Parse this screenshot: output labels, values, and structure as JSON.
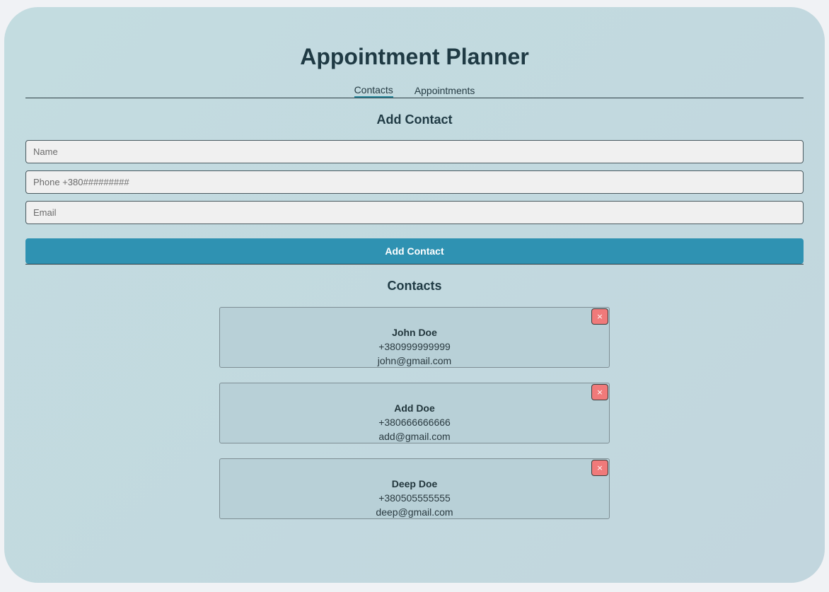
{
  "app": {
    "title": "Appointment Planner"
  },
  "nav": {
    "items": [
      {
        "label": "Contacts",
        "active": true
      },
      {
        "label": "Appointments",
        "active": false
      }
    ]
  },
  "add_contact": {
    "heading": "Add Contact",
    "fields": {
      "name": {
        "placeholder": "Name",
        "value": ""
      },
      "phone": {
        "placeholder": "Phone +380#########",
        "value": ""
      },
      "email": {
        "placeholder": "Email",
        "value": ""
      }
    },
    "submit_label": "Add Contact"
  },
  "contacts": {
    "heading": "Contacts",
    "delete_icon": "close-icon",
    "delete_glyph": "×",
    "items": [
      {
        "name": "John Doe",
        "phone": "+380999999999",
        "email": "john@gmail.com"
      },
      {
        "name": "Add Doe",
        "phone": "+380666666666",
        "email": "add@gmail.com"
      },
      {
        "name": "Deep Doe",
        "phone": "+380505555555",
        "email": "deep@gmail.com"
      }
    ]
  },
  "colors": {
    "accent": "#2f92b2",
    "delete": "#f07a7a",
    "background": "#c3dce0"
  }
}
